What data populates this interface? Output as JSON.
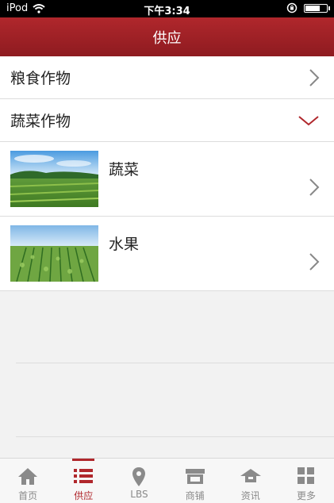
{
  "status_bar": {
    "carrier": "iPod",
    "time": "下午3:34"
  },
  "header": {
    "title": "供应"
  },
  "categories": [
    {
      "label": "粮食作物",
      "state": "collapsed"
    },
    {
      "label": "蔬菜作物",
      "state": "expanded",
      "children": [
        {
          "label": "蔬菜"
        },
        {
          "label": "水果"
        }
      ]
    }
  ],
  "tabbar": [
    {
      "label": "首页",
      "icon": "home-icon"
    },
    {
      "label": "供应",
      "icon": "list-icon",
      "active": true
    },
    {
      "label": "LBS",
      "icon": "location-pin-icon"
    },
    {
      "label": "商铺",
      "icon": "shop-icon"
    },
    {
      "label": "资讯",
      "icon": "news-icon"
    },
    {
      "label": "更多",
      "icon": "grid-icon"
    }
  ],
  "colors": {
    "accent": "#b0272c",
    "tab_inactive": "#8a8a8a"
  }
}
